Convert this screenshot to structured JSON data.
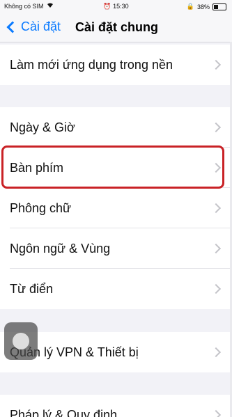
{
  "status_bar": {
    "carrier": "Không có SIM",
    "time": "15:30",
    "battery": "38%"
  },
  "nav": {
    "back_label": "Cài đặt",
    "title": "Cài đặt chung"
  },
  "groups": [
    {
      "items": [
        {
          "label": "Làm mới ứng dụng trong nền"
        }
      ]
    },
    {
      "items": [
        {
          "label": "Ngày & Giờ"
        },
        {
          "label": "Bàn phím"
        },
        {
          "label": "Phông chữ"
        },
        {
          "label": "Ngôn ngữ & Vùng"
        },
        {
          "label": "Từ điển"
        }
      ]
    },
    {
      "items": [
        {
          "label": "Quản lý VPN & Thiết bị"
        }
      ]
    },
    {
      "items": [
        {
          "label": "Pháp lý & Quy định"
        }
      ]
    }
  ],
  "highlight_color": "#c92226",
  "accent_color": "#0a7aff"
}
